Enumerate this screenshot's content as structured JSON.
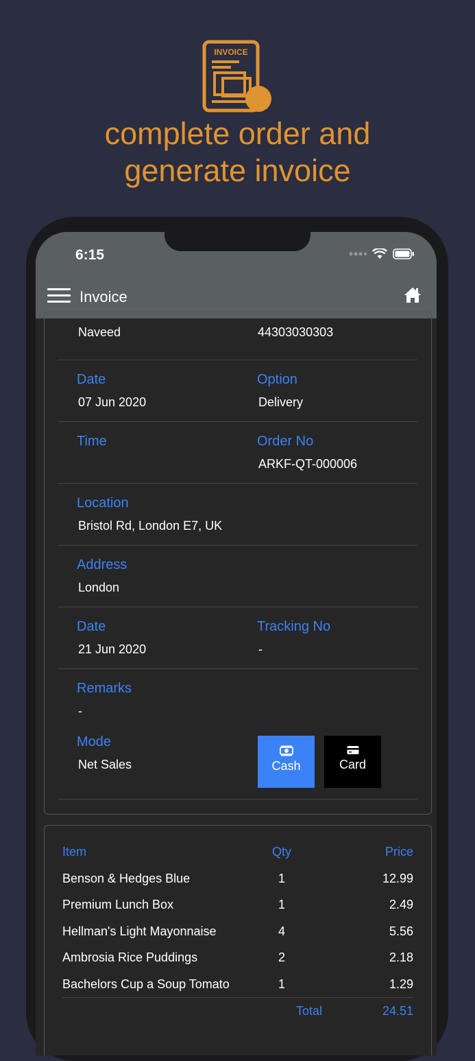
{
  "promo": {
    "icon_text": "INVOICE",
    "headline_line1": "complete order and",
    "headline_line2": "generate invoice",
    "accent": "#df9431"
  },
  "status_bar": {
    "time": "6:15"
  },
  "app_bar": {
    "title": "Invoice",
    "menu_icon": "hamburger-icon",
    "home_icon": "home-icon"
  },
  "customer": {
    "name": "Naveed",
    "phone": "44303030303"
  },
  "order": {
    "date_label": "Date",
    "date": "07 Jun 2020",
    "option_label": "Option",
    "option": "Delivery",
    "time_label": "Time",
    "time": "",
    "order_no_label": "Order No",
    "order_no": "ARKF-QT-000006",
    "location_label": "Location",
    "location": "Bristol Rd, London E7, UK",
    "address_label": "Address",
    "address": "London",
    "delivery_date_label": "Date",
    "delivery_date": "21 Jun 2020",
    "tracking_label": "Tracking No",
    "tracking": "-",
    "remarks_label": "Remarks",
    "remarks": "-",
    "mode_label": "Mode",
    "mode": "Net Sales"
  },
  "payment": {
    "cash_label": "Cash",
    "card_label": "Card",
    "cash_color": "#3b82f6"
  },
  "items": {
    "headers": {
      "item": "Item",
      "qty": "Qty",
      "price": "Price"
    },
    "rows": [
      {
        "item": "Benson & Hedges Blue",
        "qty": "1",
        "price": "12.99"
      },
      {
        "item": "Premium Lunch Box",
        "qty": "1",
        "price": "2.49"
      },
      {
        "item": "Hellman's Light Mayonnaise",
        "qty": "4",
        "price": "5.56"
      },
      {
        "item": "Ambrosia Rice Puddings",
        "qty": "2",
        "price": "2.18"
      },
      {
        "item": "Bachelors Cup a Soup Tomato",
        "qty": "1",
        "price": "1.29"
      }
    ],
    "total_label": "Total",
    "total": "24.51"
  }
}
